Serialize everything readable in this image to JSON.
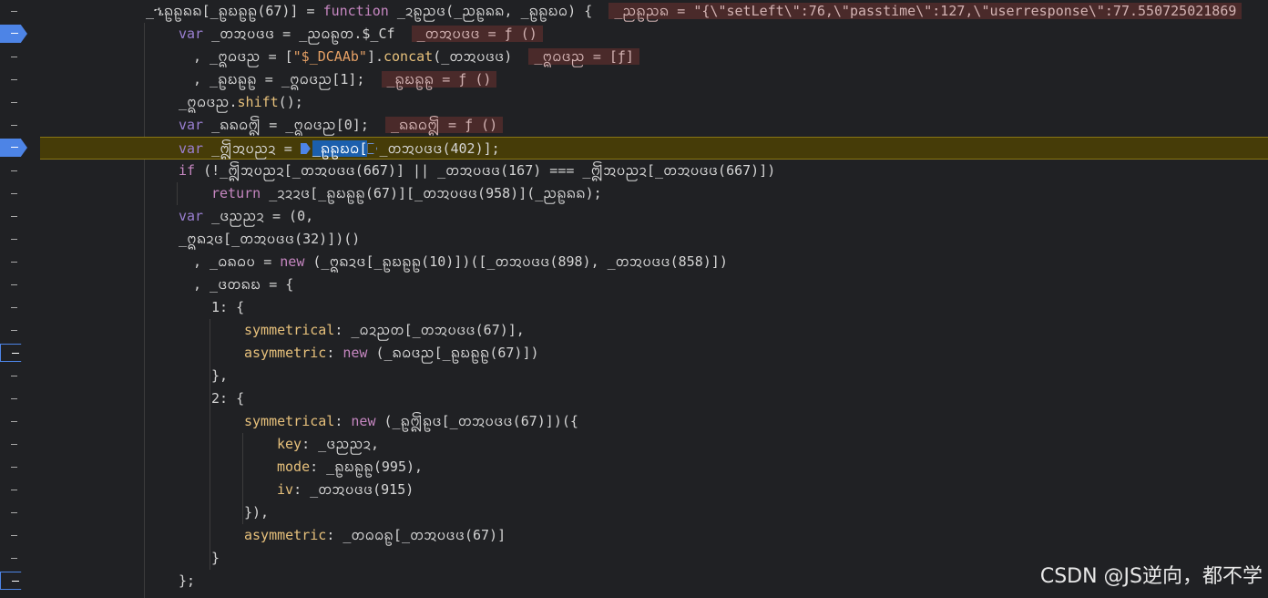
{
  "lines": [
    {
      "indent": 116,
      "parts": [
        {
          "t": "_ኄᩊᩊᨦᨦ[_ᩊᨭᩊᩊ(67)] = "
        },
        {
          "t": "function",
          "c": "kw"
        },
        {
          "t": " _ᨯᩊᨬᨴ(_ᨬᩊᨦᨦ, _ᩊᩊᨭᨵ) {  "
        },
        {
          "t": "_ᨬᩊᨬᨦ = \"{\\\"setLeft\\\":76,\\\"passtime\\\":127,\\\"userresponse\\\":77.550725021869",
          "c": "inline"
        }
      ]
    },
    {
      "indent": 152,
      "parts": [
        {
          "t": "var",
          "c": "kw2"
        },
        {
          "t": " _ᨲᩋᨷᨴᨴ = _ᨬᨵᩊᨲ.$_Cf  "
        },
        {
          "t": "_ᨲᩋᨷᨴᨴ = ƒ ()",
          "c": "inline"
        }
      ]
    },
    {
      "indent": 168,
      "parts": [
        {
          "t": ", _ᩍᨵᨴᨬ = ["
        },
        {
          "t": "\"$_DCAAb\"",
          "c": "str"
        },
        {
          "t": "]."
        },
        {
          "t": "concat",
          "c": "prop"
        },
        {
          "t": "(_ᨲᩋᨷᨴᨴ)  "
        },
        {
          "t": "_ᩍᨵᨴᨬ = [ƒ]",
          "c": "inline"
        }
      ]
    },
    {
      "indent": 168,
      "parts": [
        {
          "t": ", _ᩊᨭᩊᩊ = _ᩍᨵᨴᨬ[1];  "
        },
        {
          "t": "_ᩊᨭᩊᩊ = ƒ ()",
          "c": "inline"
        }
      ]
    },
    {
      "indent": 152,
      "parts": [
        {
          "t": "_ᩍᨵᨴᨬ."
        },
        {
          "t": "shift",
          "c": "prop"
        },
        {
          "t": "();"
        }
      ]
    },
    {
      "indent": 152,
      "parts": [
        {
          "t": "var",
          "c": "kw2"
        },
        {
          "t": " _ᨦᨦᨵᩎ = _ᩍᨵᨴᨬ[0];  "
        },
        {
          "t": "_ᨦᨦᨵᩎ = ƒ ()",
          "c": "inline"
        }
      ]
    },
    {
      "indent": 152,
      "paused": true,
      "parts": [
        {
          "t": "var",
          "c": "kw2"
        },
        {
          "t": " _ᩎᩋᨷᨬᨯ = "
        },
        {
          "t": "_ᩊᩊᨭᨵ",
          "c": "hl",
          "mark": "solid"
        },
        {
          "t": "[",
          "c": "hl"
        },
        {
          "t": "_ᨲᩋᨷᨴᨴ(402)];",
          "mark": "outline"
        }
      ]
    },
    {
      "indent": 152,
      "parts": [
        {
          "t": "if",
          "c": "kw"
        },
        {
          "t": " (!_ᩎᩋᨷᨬᨯ[_ᨲᩋᨷᨴᨴ(667)] || _ᨲᩋᨷᨴᨴ(167) === _ᩎᩋᨷᨬᨯ[_ᨲᩋᨷᨴᨴ(667)])"
        }
      ]
    },
    {
      "indent": 188,
      "parts": [
        {
          "t": "return",
          "c": "kw"
        },
        {
          "t": " _ᨯᨯᨯᨴ[_ᩊᨭᩊᩊ(67)][_ᨲᩋᨷᨴᨴ(958)](_ᨬᩊᨦᨦ);"
        }
      ]
    },
    {
      "indent": 152,
      "parts": [
        {
          "t": "var",
          "c": "kw2"
        },
        {
          "t": " _ᨴᨬᨬᨯ = (0,"
        }
      ]
    },
    {
      "indent": 152,
      "parts": [
        {
          "t": "_ᩍᨦᨯᨴ[_ᨲᩋᨷᨴᨴ(32)])()"
        }
      ]
    },
    {
      "indent": 168,
      "parts": [
        {
          "t": ", _ᨵᨦᨵᨷ = "
        },
        {
          "t": "new",
          "c": "kw"
        },
        {
          "t": " (_ᩍᨦᨯᨴ[_ᩊᨭᩊᩊ(10)])([_ᨲᩋᨷᨴᨴ(898), _ᨲᩋᨷᨴᨴ(858)])"
        }
      ]
    },
    {
      "indent": 168,
      "parts": [
        {
          "t": ", _ᨴᨲᨦᨭ = {"
        }
      ]
    },
    {
      "indent": 188,
      "parts": [
        {
          "t": "1: {"
        }
      ]
    },
    {
      "indent": 224,
      "parts": [
        {
          "t": "symmetrical",
          "c": "prop"
        },
        {
          "t": ": _ᨵᨯᨬᨲ[_ᨲᩋᨷᨴᨴ(67)],"
        }
      ]
    },
    {
      "indent": 224,
      "parts": [
        {
          "t": "asymmetric",
          "c": "prop"
        },
        {
          "t": ": "
        },
        {
          "t": "new",
          "c": "kw"
        },
        {
          "t": " (_ᨦᨵᨴᨬ[_ᩊᨭᩊᩊ(67)])"
        }
      ]
    },
    {
      "indent": 188,
      "parts": [
        {
          "t": "},"
        }
      ]
    },
    {
      "indent": 188,
      "parts": [
        {
          "t": "2: {"
        }
      ]
    },
    {
      "indent": 224,
      "parts": [
        {
          "t": "symmetrical",
          "c": "prop"
        },
        {
          "t": ": "
        },
        {
          "t": "new",
          "c": "kw"
        },
        {
          "t": " (_ᩊᩎᩊᨴ[_ᨲᩋᨷᨴᨴ(67)])({"
        }
      ]
    },
    {
      "indent": 260,
      "parts": [
        {
          "t": "key",
          "c": "prop"
        },
        {
          "t": ": _ᨴᨬᨬᨯ,"
        }
      ]
    },
    {
      "indent": 260,
      "parts": [
        {
          "t": "mode",
          "c": "prop"
        },
        {
          "t": ": _ᩊᨭᩊᩊ(995),"
        }
      ]
    },
    {
      "indent": 260,
      "parts": [
        {
          "t": "iv",
          "c": "prop"
        },
        {
          "t": ": _ᨲᩋᨷᨴᨴ(915)"
        }
      ]
    },
    {
      "indent": 224,
      "parts": [
        {
          "t": "}),"
        }
      ]
    },
    {
      "indent": 224,
      "parts": [
        {
          "t": "asymmetric",
          "c": "prop"
        },
        {
          "t": ": _ᨲᨵᨵᩊ[_ᨲᩋᨷᨴᨴ(67)]"
        }
      ]
    },
    {
      "indent": 188,
      "parts": [
        {
          "t": "}"
        }
      ]
    },
    {
      "indent": 152,
      "parts": [
        {
          "t": "};"
        }
      ]
    }
  ],
  "gutter_markers": [
    "dash",
    "bp-solid",
    "dash",
    "dash",
    "dash",
    "dash",
    "bp-solid",
    "dash",
    "dash",
    "dash",
    "dash",
    "dash",
    "dash",
    "dash",
    "dash",
    "bp-outline",
    "dash",
    "dash",
    "dash",
    "dash",
    "dash",
    "dash",
    "dash",
    "dash",
    "dash",
    "bp-outline"
  ],
  "watermark": "CSDN @JS逆向，都不学"
}
